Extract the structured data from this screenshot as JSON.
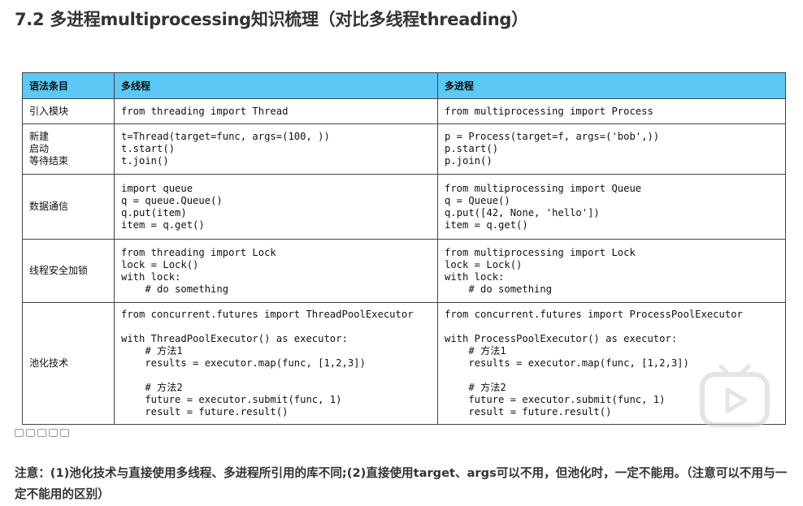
{
  "title": "7.2 多进程multiprocessing知识梳理（对比多线程threading）",
  "table": {
    "headers": [
      "语法条目",
      "多线程",
      "多进程"
    ],
    "rows": [
      {
        "label": "引入模块",
        "thread": "from threading import Thread",
        "process": "from multiprocessing import Process"
      },
      {
        "label": "新建\n启动\n等待结束",
        "thread": "t=Thread(target=func, args=(100, ))\nt.start()\nt.join()",
        "process": "p = Process(target=f, args=('bob',))\np.start()\np.join()"
      },
      {
        "label": "数据通信",
        "thread": "import queue\nq = queue.Queue()\nq.put(item)\nitem = q.get()",
        "process": "from multiprocessing import Queue\nq = Queue()\nq.put([42, None, 'hello'])\nitem = q.get()"
      },
      {
        "label": "线程安全加锁",
        "thread": "from threading import Lock\nlock = Lock()\nwith lock:\n    # do something",
        "process": "from multiprocessing import Lock\nlock = Lock()\nwith lock:\n    # do something"
      },
      {
        "label": "池化技术",
        "thread": "from concurrent.futures import ThreadPoolExecutor\n\nwith ThreadPoolExecutor() as executor:\n    # 方法1\n    results = executor.map(func, [1,2,3])\n\n    # 方法2\n    future = executor.submit(func, 1)\n    result = future.result()",
        "process": "from concurrent.futures import ProcessPoolExecutor\n\nwith ProcessPoolExecutor() as executor:\n    # 方法1\n    results = executor.map(func, [1,2,3])\n\n    # 方法2\n    future = executor.submit(func, 1)\n    result = future.result()"
      }
    ]
  },
  "note": "注意：(1)池化技术与直接使用多线程、多进程所引用的库不同;(2)直接使用target、args可以不用，但池化时，一定不能用。（注意可以不用与一定不能用的区别）",
  "icons": {
    "toolbar": [
      "copy-icon",
      "settings-icon",
      "link-icon",
      "edit-icon",
      "comment-icon"
    ],
    "watermark": "bilibili-tv-play-icon"
  },
  "colors": {
    "header_bg": "#5bc8f5",
    "border": "#444444"
  }
}
